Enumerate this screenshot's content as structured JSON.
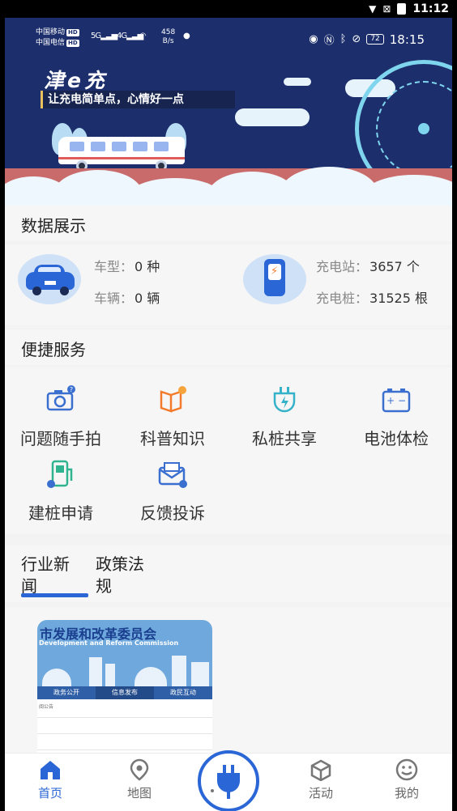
{
  "system_bar": {
    "time": "11:12"
  },
  "status_bar": {
    "carrier_1": "中国移动",
    "carrier_2": "中国电信",
    "hd": "HD",
    "net_1": "5G",
    "net_2": "4G",
    "speed_value": "458",
    "speed_unit": "B/s",
    "battery": "72",
    "time": "18:15"
  },
  "banner": {
    "brand": "津e充",
    "slogan": "让充电简单点，心情好一点"
  },
  "data_section": {
    "title": "数据展示",
    "vehicle_type_label": "车型：",
    "vehicle_type_value": "0 种",
    "vehicle_count_label": "车辆：",
    "vehicle_count_value": "0 辆",
    "station_label": "充电站：",
    "station_value": "3657 个",
    "pile_label": "充电桩：",
    "pile_value": "31525 根"
  },
  "services": {
    "title": "便捷服务",
    "items": [
      {
        "label": "问题随手拍",
        "icon": "camera-icon"
      },
      {
        "label": "科普知识",
        "icon": "book-icon"
      },
      {
        "label": "私桩共享",
        "icon": "plug-icon"
      },
      {
        "label": "电池体检",
        "icon": "battery-icon"
      },
      {
        "label": "建桩申请",
        "icon": "charging-pile-icon"
      },
      {
        "label": "反馈投诉",
        "icon": "mail-icon"
      }
    ]
  },
  "news": {
    "tabs": [
      {
        "label_line1": "行业新",
        "label_line2": "闻"
      },
      {
        "label_line1": "政策法",
        "label_line2": "规"
      }
    ],
    "card": {
      "title": "市发展和改革委员会",
      "subtitle": "Development and Reform Commission",
      "nav": [
        "政务公开",
        "信息发布",
        "政民互动"
      ],
      "small_text": "阅公告"
    }
  },
  "bottom_nav": {
    "items": [
      {
        "label": "首页",
        "icon": "home-icon"
      },
      {
        "label": "地图",
        "icon": "map-pin-icon"
      },
      {
        "label": "活动",
        "icon": "cube-icon"
      },
      {
        "label": "我的",
        "icon": "smiley-icon"
      }
    ]
  },
  "colors": {
    "accent": "#2a66d6",
    "banner_bg": "#1c2f6c",
    "page_bg": "#f3f3f3"
  }
}
